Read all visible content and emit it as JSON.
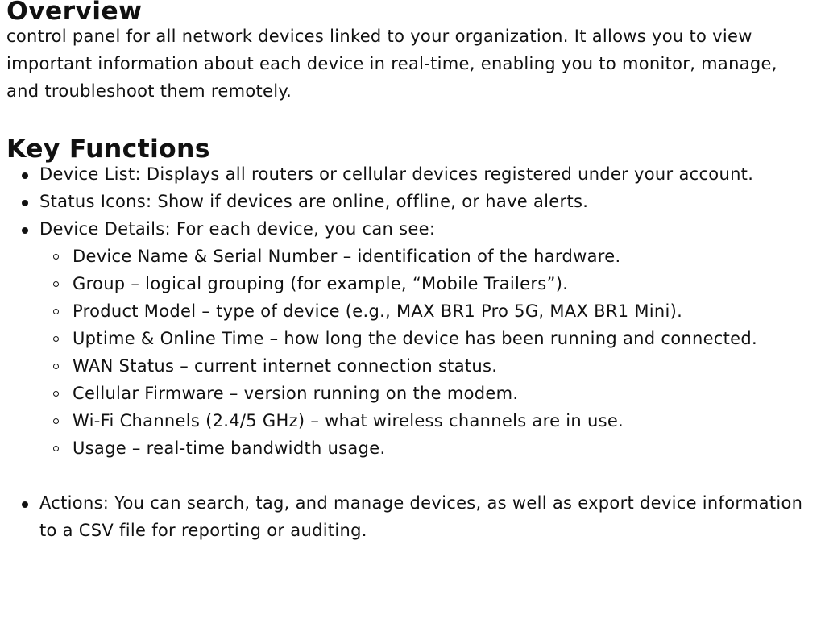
{
  "overview": {
    "heading": "Overview",
    "text": "control panel for all network devices linked to your organization. It allows you to view important information about each device in real-time, enabling you to monitor, manage, and troubleshoot them remotely."
  },
  "key_functions": {
    "heading": "Key Functions",
    "items": [
      {
        "text": "Device List: Displays all routers or cellular devices registered under your account."
      },
      {
        "text": "Status Icons: Show if devices are online, offline, or have alerts."
      },
      {
        "text": "Device Details: For each device, you can see:",
        "subitems": [
          "Device Name & Serial Number – identification of the hardware.",
          "Group – logical grouping (for example, “Mobile Trailers”).",
          "Product Model – type of device (e.g., MAX BR1 Pro 5G, MAX BR1 Mini).",
          "Uptime & Online Time – how long the device has been running and connected.",
          "WAN Status – current internet connection status.",
          "Cellular Firmware – version running on the modem.",
          "Wi-Fi Channels (2.4/5 GHz) – what wireless channels are in use.",
          "Usage – real-time bandwidth usage."
        ]
      },
      {
        "text": "Actions: You can search, tag, and manage devices, as well as export device information to a CSV file for reporting or auditing."
      }
    ]
  }
}
